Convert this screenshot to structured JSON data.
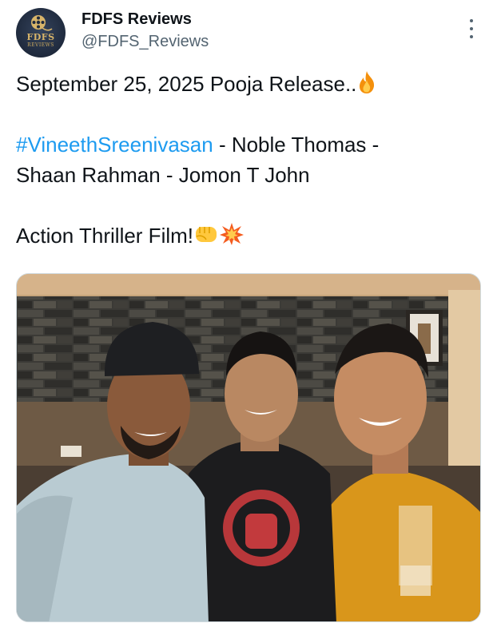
{
  "author": {
    "display_name": "FDFS Reviews",
    "handle": "@FDFS_Reviews",
    "avatar_logo_text": "FDFS",
    "avatar_logo_subtext": "REVIEWS"
  },
  "tweet": {
    "line1": "September 25, 2025 Pooja Release..",
    "line1_emoji": "fire-emoji",
    "hashtag": "#VineethSreenivasan",
    "line2_rest": " - Noble Thomas -",
    "line3": "Shaan Rahman - Jomon T John",
    "line4": "Action Thriller Film!",
    "line4_emojis": [
      "oncoming-fist-emoji",
      "collision-emoji"
    ]
  },
  "media": {
    "description": "three men smiling selfie"
  },
  "colors": {
    "text": "#0f1419",
    "secondary": "#536471",
    "link": "#1d9bf0",
    "background": "#ffffff"
  },
  "icons": [
    "more-options-icon"
  ]
}
